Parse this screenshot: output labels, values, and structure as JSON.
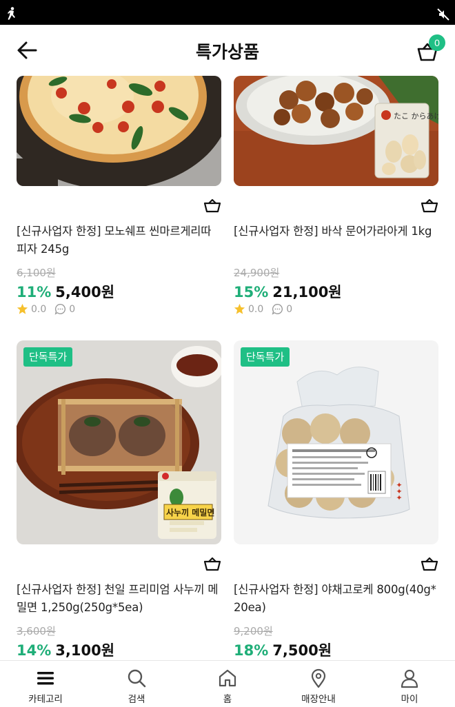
{
  "header": {
    "title": "특가상품",
    "cart_count": "0"
  },
  "products": [
    {
      "name": "[신규사업자 한정] 모노쉐프 씬마르게리따피자 245g",
      "original_price": "6,100원",
      "discount": "11%",
      "price": "5,400원",
      "rating": "0.0",
      "comments": "0",
      "badge": "",
      "image": "pizza"
    },
    {
      "name": "[신규사업자 한정] 바삭 문어가라아게 1kg",
      "original_price": "24,900원",
      "discount": "15%",
      "price": "21,100원",
      "rating": "0.0",
      "comments": "0",
      "badge": "",
      "image": "fried-octopus"
    },
    {
      "name": "[신규사업자 한정] 천일 프리미엄 사누끼 메밀면 1,250g(250g*5ea)",
      "original_price": "3,600원",
      "discount": "14%",
      "price": "3,100원",
      "badge": "단독특가",
      "image": "buckwheat-noodles"
    },
    {
      "name": "[신규사업자 한정] 야채고로케 800g(40g*20ea)",
      "original_price": "9,200원",
      "discount": "18%",
      "price": "7,500원",
      "badge": "단독특가",
      "image": "croquette"
    }
  ],
  "package_text": {
    "octopus": "たこ からあげ",
    "noodle": "사누끼 메밀면"
  },
  "tabbar": [
    {
      "label": "카테고리",
      "icon": "menu-icon"
    },
    {
      "label": "검색",
      "icon": "search-icon"
    },
    {
      "label": "홈",
      "icon": "home-icon"
    },
    {
      "label": "매장안내",
      "icon": "location-pin-icon"
    },
    {
      "label": "마이",
      "icon": "user-icon"
    }
  ],
  "colors": {
    "accent": "#1fbf85",
    "discount": "#1fae78"
  }
}
